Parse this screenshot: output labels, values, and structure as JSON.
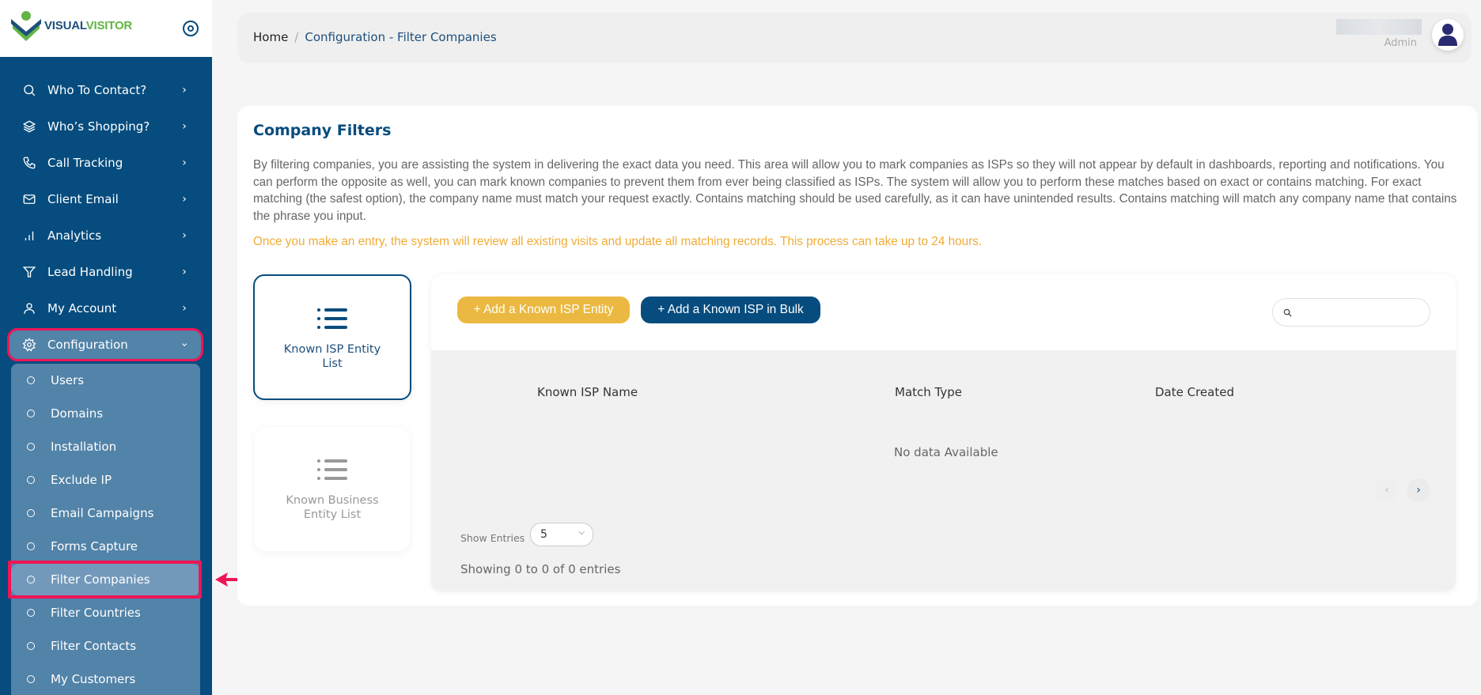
{
  "brand": {
    "name_part1": "VISUAL",
    "name_part2": "VISITOR"
  },
  "colors": {
    "sidebar_bg": "#064c7e",
    "accent_yellow": "#ebb941",
    "accent_blue": "#064c7e",
    "highlight_red": "#ef1556",
    "note_orange": "#f0ac36",
    "logo_green": "#62b446"
  },
  "sidebar": {
    "items": [
      {
        "label": "Who To Contact?",
        "icon": "search-icon"
      },
      {
        "label": "Who’s Shopping?",
        "icon": "layers-icon"
      },
      {
        "label": "Call Tracking",
        "icon": "phone-icon"
      },
      {
        "label": "Client Email",
        "icon": "mail-icon"
      },
      {
        "label": "Analytics",
        "icon": "bar-chart-icon"
      },
      {
        "label": "Lead Handling",
        "icon": "filter-icon"
      },
      {
        "label": "My Account",
        "icon": "user-icon"
      },
      {
        "label": "Configuration",
        "icon": "gear-icon",
        "expanded": true
      }
    ],
    "submenu": [
      {
        "label": "Users"
      },
      {
        "label": "Domains"
      },
      {
        "label": "Installation"
      },
      {
        "label": "Exclude IP"
      },
      {
        "label": "Email Campaigns"
      },
      {
        "label": "Forms Capture"
      },
      {
        "label": "Filter Companies",
        "active": true
      },
      {
        "label": "Filter Countries"
      },
      {
        "label": "Filter Contacts"
      },
      {
        "label": "My Customers"
      }
    ]
  },
  "header": {
    "breadcrumb": {
      "home": "Home",
      "separator": "/",
      "current": "Configuration - Filter Companies"
    },
    "user": {
      "role": "Admin"
    }
  },
  "main": {
    "title": "Company Filters",
    "description": "By filtering companies, you are assisting the system in delivering the exact data you need. This area will allow you to mark companies as ISPs so they will not appear by default in dashboards, reporting and notifications. You can perform the opposite as well, you can mark known companies to prevent them from ever being classified as ISPs. The system will allow you to perform these matches based on exact or contains matching. For exact matching (the safest option), the company name must match your request exactly. Contains matching should be used carefully, as it can have unintended results. Contains matching will match any company name that contains the phrase you input.",
    "note": "Once you make an entry, the system will review all existing visits and update all matching records. This process can take up to 24 hours.",
    "tabs": [
      {
        "label": "Known ISP Entity List",
        "active": true
      },
      {
        "label": "Known Business Entity List",
        "active": false
      }
    ],
    "table": {
      "add_button": "+  Add a Known ISP Entity",
      "bulk_button": "+  Add a Known ISP in Bulk",
      "search_placeholder": "",
      "columns": [
        "Known ISP Name",
        "Match Type",
        "Date Created"
      ],
      "rows": [],
      "empty_text": "No data Available",
      "pagination": {
        "prev": "‹",
        "next": "›"
      },
      "show_entries_label": "Show Entries",
      "entries_value": "5",
      "showing_text": "Showing 0 to 0 of 0 entries"
    }
  }
}
